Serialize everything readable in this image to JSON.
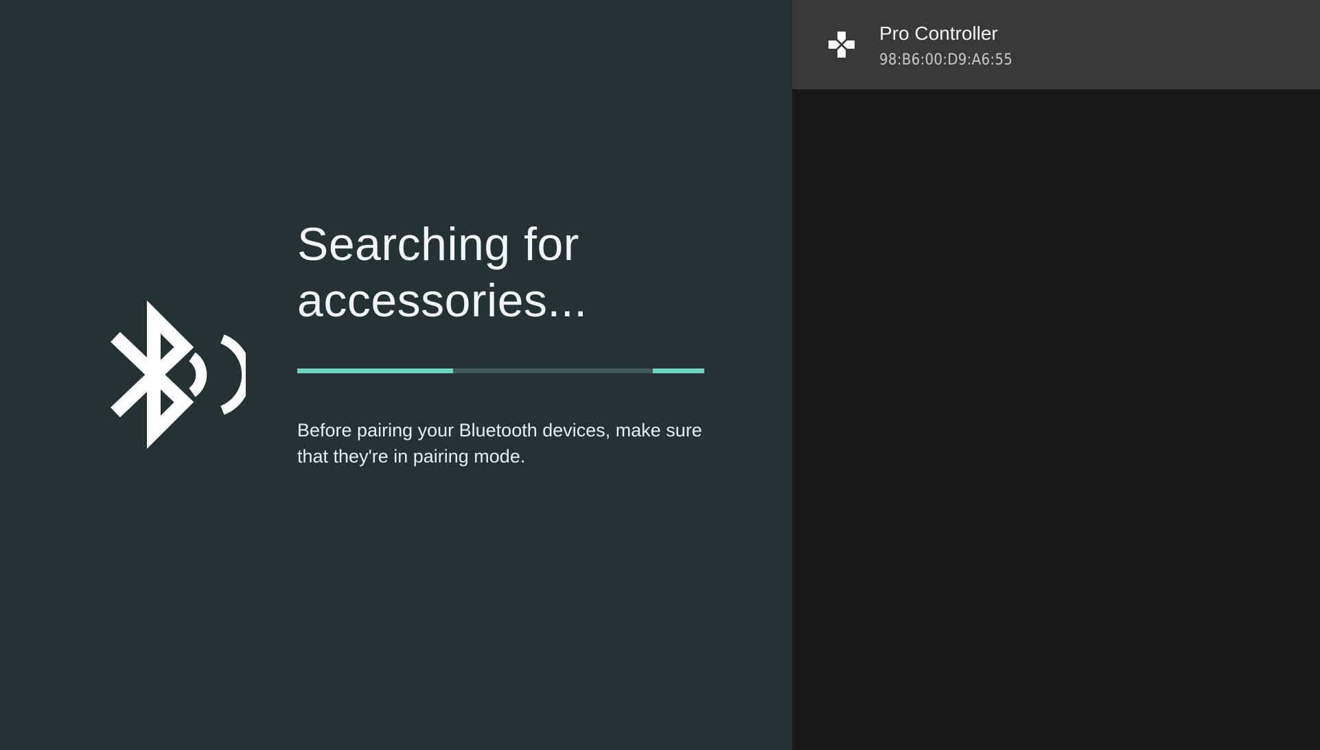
{
  "main": {
    "title_line1": "Searching for",
    "title_line2": "accessories...",
    "description": "Before pairing your Bluetooth devices, make sure that they're in pairing mode.",
    "icon": "bluetooth-searching-icon"
  },
  "devices": [
    {
      "name": "Pro Controller",
      "address": "98:B6:00:D9:A6:55",
      "icon": "gamepad-icon"
    }
  ],
  "colors": {
    "left_background": "#263133",
    "right_background": "#181818",
    "selected_item": "#393939",
    "progress_track": "#3f5b57",
    "progress_accent": "#6ad6bb"
  }
}
